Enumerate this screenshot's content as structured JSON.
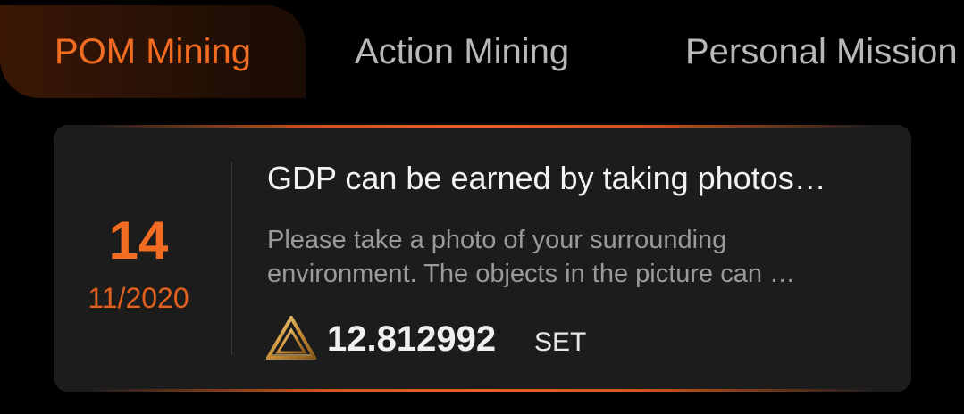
{
  "tabs": [
    {
      "label": "POM Mining",
      "active": true
    },
    {
      "label": "Action Mining",
      "active": false
    },
    {
      "label": "Personal Mission",
      "active": false
    }
  ],
  "card": {
    "day": "14",
    "month_year": "11/2020",
    "title": "GDP can be earned by taking photos…",
    "description_line1": "Please take a photo of your surrounding",
    "description_line2": "environment. The objects in the picture can …",
    "reward_icon": "gold-triangle-token-icon",
    "reward_amount": "12.812992",
    "reward_unit": "SET"
  },
  "colors": {
    "accent": "#f26d21",
    "background": "#000000",
    "card": "#1c1c1c",
    "tab_inactive": "#b8b8b8"
  }
}
